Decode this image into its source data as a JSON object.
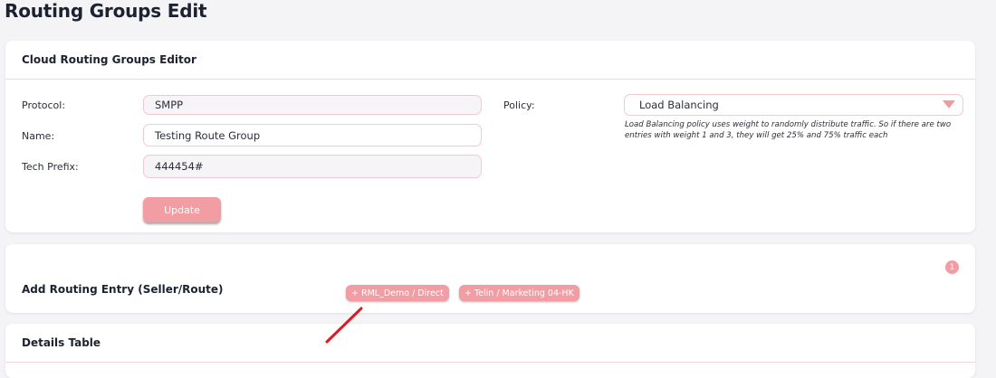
{
  "page": {
    "title": "Routing Groups Edit"
  },
  "editor": {
    "title": "Cloud Routing Groups Editor",
    "protocol": {
      "label": "Protocol:",
      "value": "SMPP"
    },
    "name": {
      "label": "Name:",
      "value": "Testing Route Group"
    },
    "tech_prefix": {
      "label": "Tech Prefix:",
      "value": "444454#"
    },
    "policy": {
      "label": "Policy:",
      "value": "Load Balancing",
      "hint": "Load Balancing policy uses weight to randomly distribute traffic. So if there are two entries with weight 1 and 3, they will get 25% and 75% traffic each"
    },
    "update_label": "Update"
  },
  "add_entry": {
    "title": "Add Routing Entry (Seller/Route)",
    "count": "1",
    "chips": [
      "+ RML_Demo / Direct",
      "+ Telin / Marketing 04-HK"
    ]
  },
  "details": {
    "title": "Details Table"
  },
  "colors": {
    "accent": "#f29ca3",
    "annotation": "#e01822"
  },
  "icons": {
    "policy_dropdown": "caret-down-icon"
  }
}
